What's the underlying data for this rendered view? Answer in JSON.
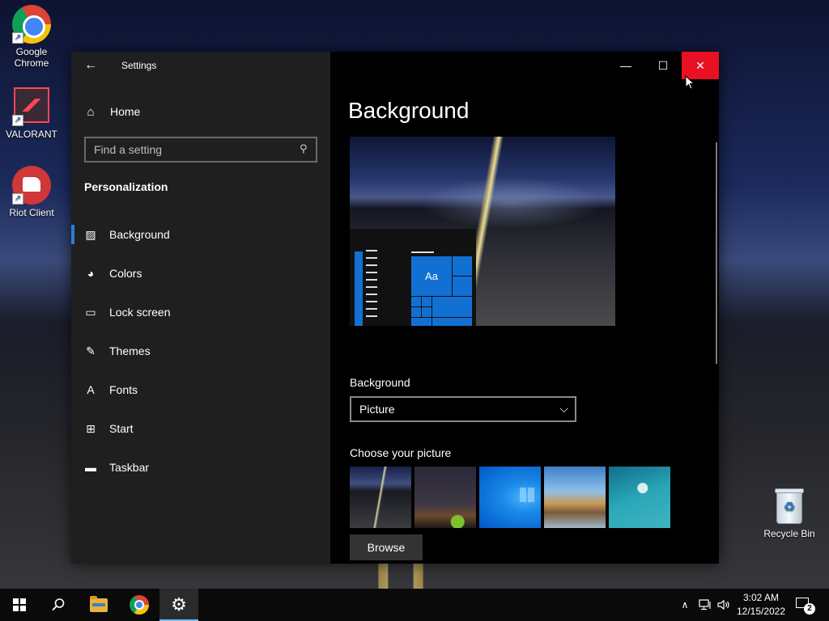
{
  "desktop": {
    "icons": [
      {
        "label_line1": "Google",
        "label_line2": "Chrome"
      },
      {
        "label_line1": "VALORANT"
      },
      {
        "label_line1": "Riot Client"
      },
      {
        "label_line1": "Recycle Bin"
      }
    ]
  },
  "window": {
    "title": "Settings",
    "back_glyph": "←",
    "caption": {
      "minimize": "—",
      "maximize": "☐",
      "close": "✕"
    }
  },
  "sidebar": {
    "home_label": "Home",
    "home_icon": "⌂",
    "search_placeholder": "Find a setting",
    "search_icon": "⚲",
    "section_title": "Personalization",
    "items": [
      {
        "label": "Background",
        "icon": "▨",
        "active": true
      },
      {
        "label": "Colors",
        "icon": "◕"
      },
      {
        "label": "Lock screen",
        "icon": "▭"
      },
      {
        "label": "Themes",
        "icon": "✎"
      },
      {
        "label": "Fonts",
        "icon": "A"
      },
      {
        "label": "Start",
        "icon": "⊞"
      },
      {
        "label": "Taskbar",
        "icon": "▬"
      }
    ]
  },
  "content": {
    "page_title": "Background",
    "preview_tile_text": "Aa",
    "background_label": "Background",
    "background_value": "Picture",
    "choose_label": "Choose your picture",
    "browse_label": "Browse"
  },
  "taskbar": {
    "time": "3:02 AM",
    "date": "12/15/2022",
    "notification_count": "2",
    "tray": {
      "chevron": "∧",
      "network": "▭",
      "volume": "🕪"
    }
  },
  "colors": {
    "accent": "#2d7dd2",
    "close_hover": "#e81123",
    "tile_blue": "#1370d3"
  }
}
